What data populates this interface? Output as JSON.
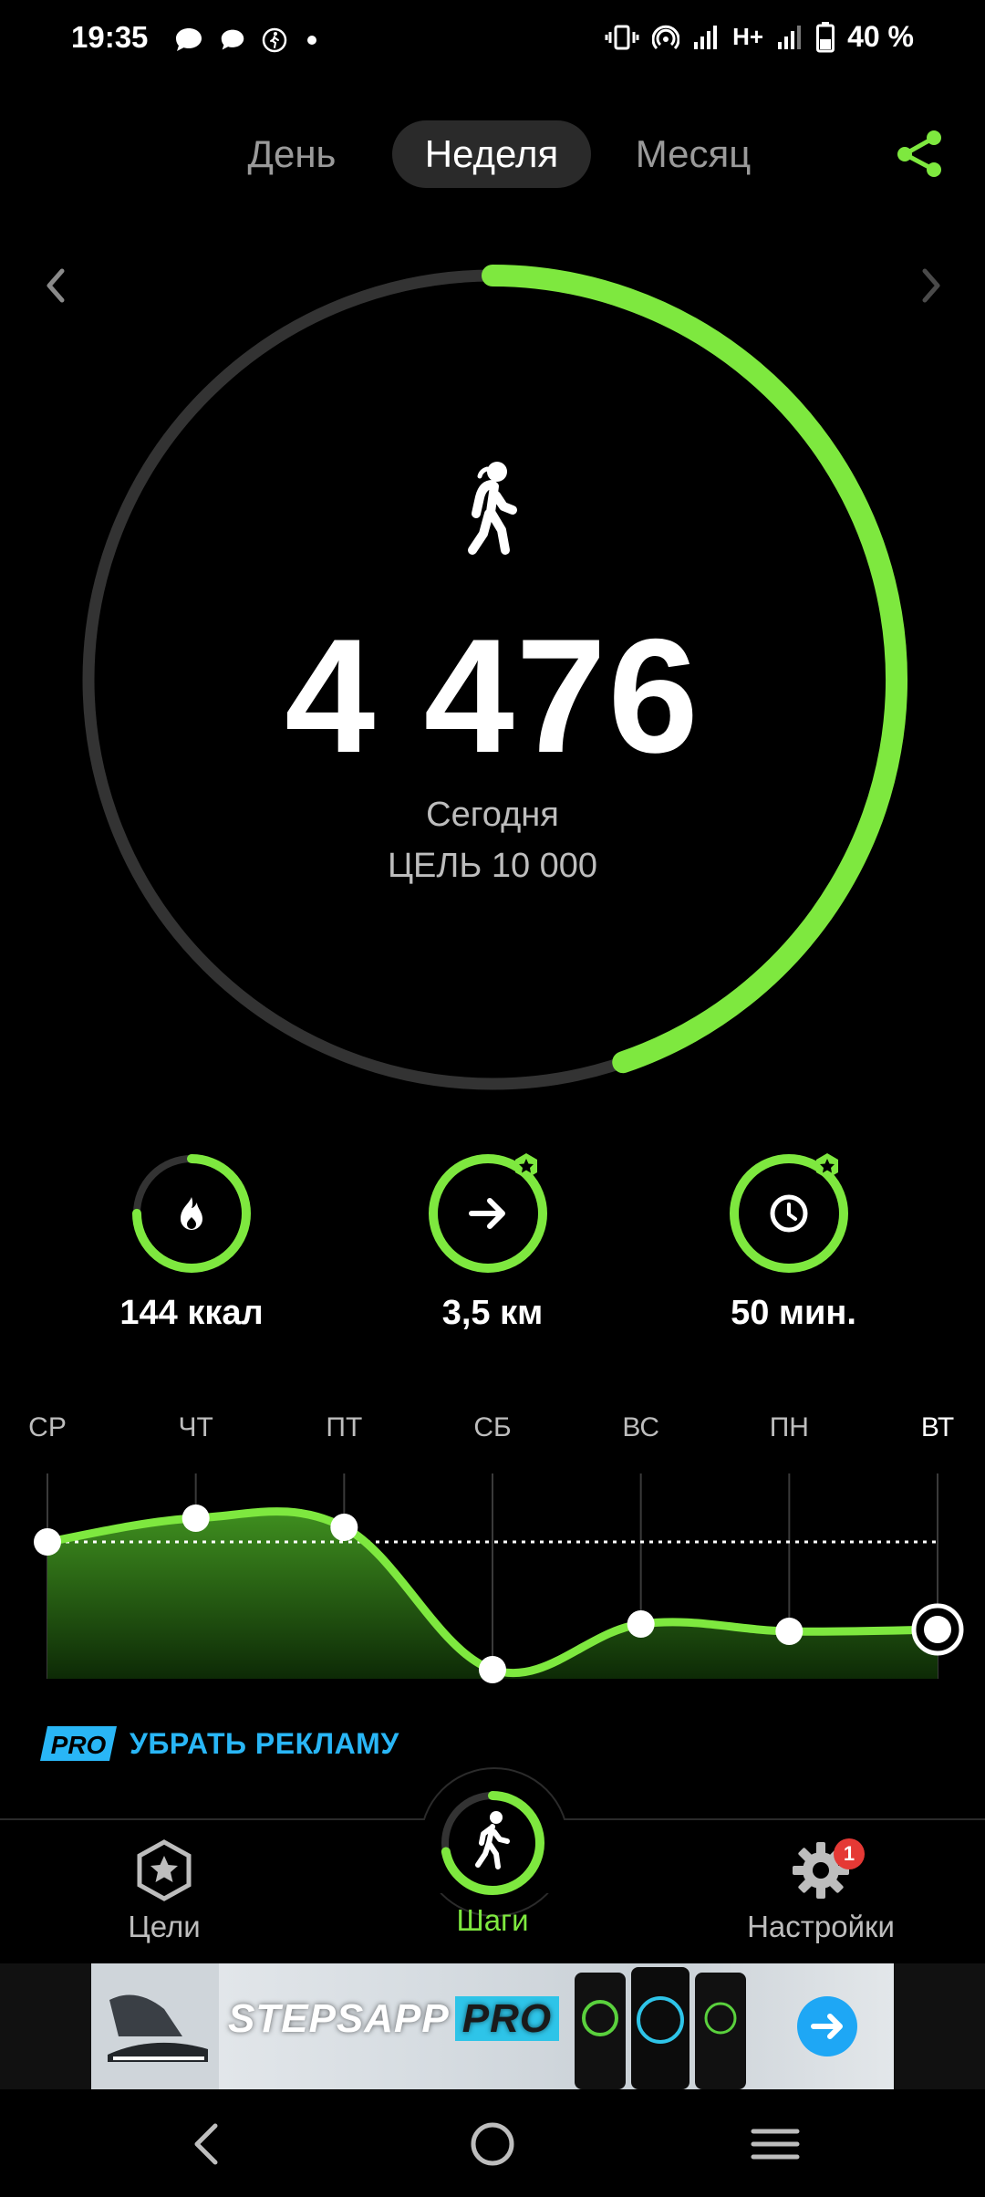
{
  "status_bar": {
    "time": "19:35",
    "battery": "40 %",
    "network_type": "H+",
    "icons": [
      "chat-bubble-icon",
      "chat-bubble-icon",
      "walking-notification-icon",
      "dot-icon",
      "vibrate-icon",
      "hotspot-icon",
      "signal-icon",
      "signal-icon",
      "battery-icon"
    ]
  },
  "period_tabs": [
    {
      "label": "День",
      "active": false
    },
    {
      "label": "Неделя",
      "active": true
    },
    {
      "label": "Месяц",
      "active": false
    }
  ],
  "share_icon": "share-icon",
  "main": {
    "steps": "4 476",
    "period": "Сегодня",
    "goal": "ЦЕЛЬ 10 000",
    "progress": 0.4476,
    "accent": "#7ee83f",
    "track": "#333333"
  },
  "metrics": [
    {
      "value": "144 ккал",
      "icon": "flame-icon",
      "progress": 0.75,
      "star": false
    },
    {
      "value": "3,5 км",
      "icon": "arrow-right-icon",
      "progress": 1.0,
      "star": true
    },
    {
      "value": "50 мин.",
      "icon": "clock-icon",
      "progress": 1.0,
      "star": true
    }
  ],
  "chart_data": {
    "type": "area",
    "categories": [
      "СР",
      "ЧТ",
      "ПТ",
      "СБ",
      "ВС",
      "ПН",
      "ВТ"
    ],
    "series": [
      {
        "values": [
          0.7,
          0.83,
          0.78,
          0.0,
          0.25,
          0.21,
          0.22
        ]
      }
    ],
    "goal_line": 0.7,
    "ylim": [
      0,
      1
    ],
    "current_index": 6
  },
  "pro_link": {
    "badge": "PRO",
    "label": "УБРАТЬ РЕКЛАМУ"
  },
  "bottom_nav": [
    {
      "label": "Цели",
      "icon": "star-badge-icon",
      "active": false
    },
    {
      "label": "Шаги",
      "icon": "walking-icon",
      "active": true
    },
    {
      "label": "Настройки",
      "icon": "gear-icon",
      "active": false,
      "badge": "1"
    }
  ],
  "ad": {
    "brand": "STEPSAPP",
    "brand_suffix": "PRO",
    "icon": "arrow-circle-icon"
  },
  "system_nav": [
    "back-icon",
    "home-icon",
    "recents-icon"
  ]
}
